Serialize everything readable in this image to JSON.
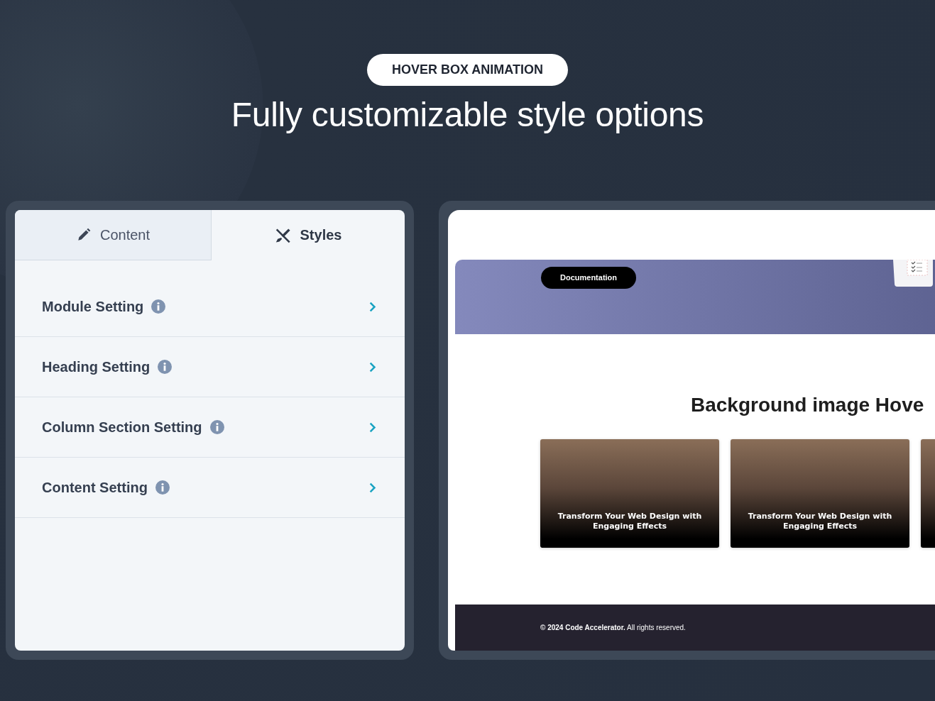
{
  "badge": "HOVER BOX ANIMATION",
  "title": "Fully customizable style options",
  "settings_panel": {
    "tabs": [
      {
        "label": "Content",
        "selected": false
      },
      {
        "label": "Styles",
        "selected": true
      }
    ],
    "rows": [
      {
        "label": "Module Setting"
      },
      {
        "label": "Heading Setting"
      },
      {
        "label": "Column Section Setting"
      },
      {
        "label": "Content Setting"
      }
    ]
  },
  "preview": {
    "button": "Documentation",
    "heading": "Background image Hove",
    "cards": [
      {
        "kind": "titled",
        "title": "Transform Your Web Design with Engaging Effects"
      },
      {
        "kind": "titled",
        "title": "Transform Your Web Design with Engaging Effects"
      },
      {
        "kind": "plain"
      }
    ],
    "footer": "**© 2024 Code Accelerator.** All rights reserved."
  }
}
